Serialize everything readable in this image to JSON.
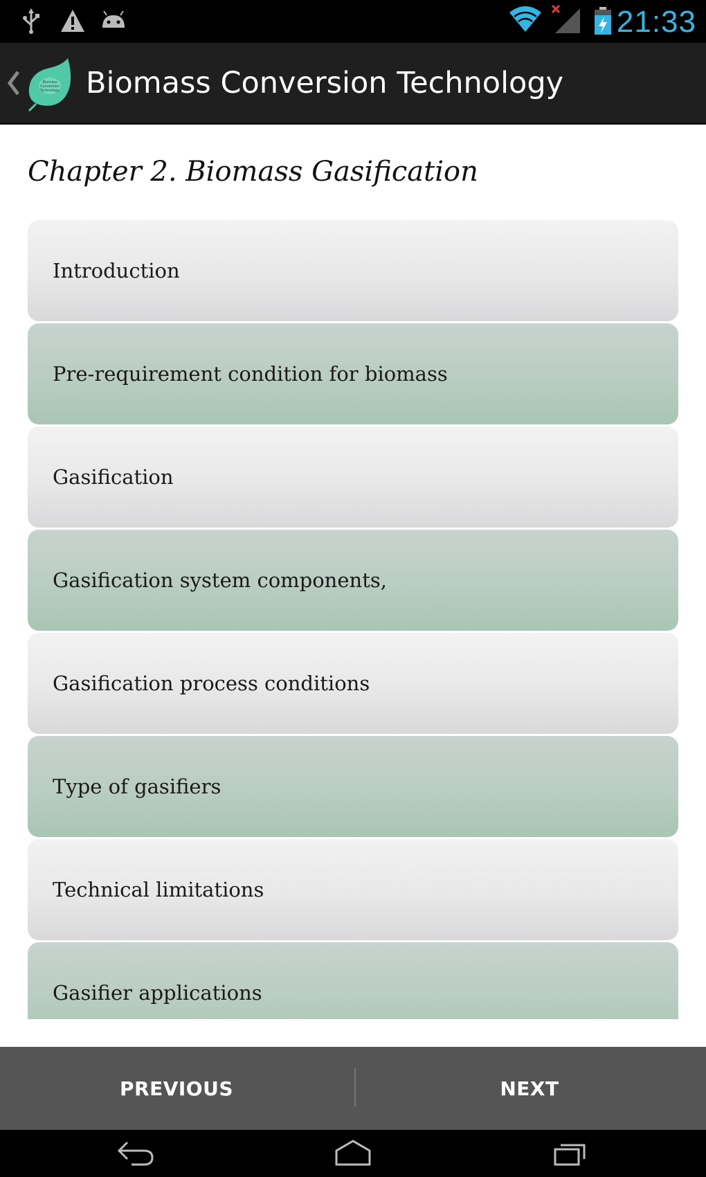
{
  "status_bar": {
    "time": "21:33",
    "icons": [
      "usb-icon",
      "warning-icon",
      "android-icon",
      "wifi-icon",
      "signal-icon",
      "battery-icon"
    ],
    "clock_color": "#33b5e5"
  },
  "action_bar": {
    "title": "Biomass Conversion Technology",
    "logo_icon": "leaf-logo-icon",
    "logo_text": "Biomass Conversion Technology",
    "logo_color": "#4fc9a7"
  },
  "chapter": {
    "title": "Chapter 2. Biomass Gasification"
  },
  "topics": [
    {
      "label": "Introduction",
      "style": "light"
    },
    {
      "label": "Pre-requirement condition for biomass",
      "style": "green"
    },
    {
      "label": "Gasification",
      "style": "light"
    },
    {
      "label": "Gasification system components,",
      "style": "green"
    },
    {
      "label": "Gasification process conditions",
      "style": "light"
    },
    {
      "label": "Type of gasifiers",
      "style": "green"
    },
    {
      "label": "Technical limitations",
      "style": "light"
    },
    {
      "label": "Gasifier applications",
      "style": "green"
    }
  ],
  "bottom_buttons": {
    "previous_label": "PREVIOUS",
    "next_label": "NEXT"
  },
  "nav_bar": {
    "buttons": [
      "back-icon",
      "home-icon",
      "recents-icon"
    ]
  },
  "colors": {
    "light_item": "#e8e8e9",
    "green_item": "#b9cdc2",
    "bottom_bar": "#555555"
  }
}
